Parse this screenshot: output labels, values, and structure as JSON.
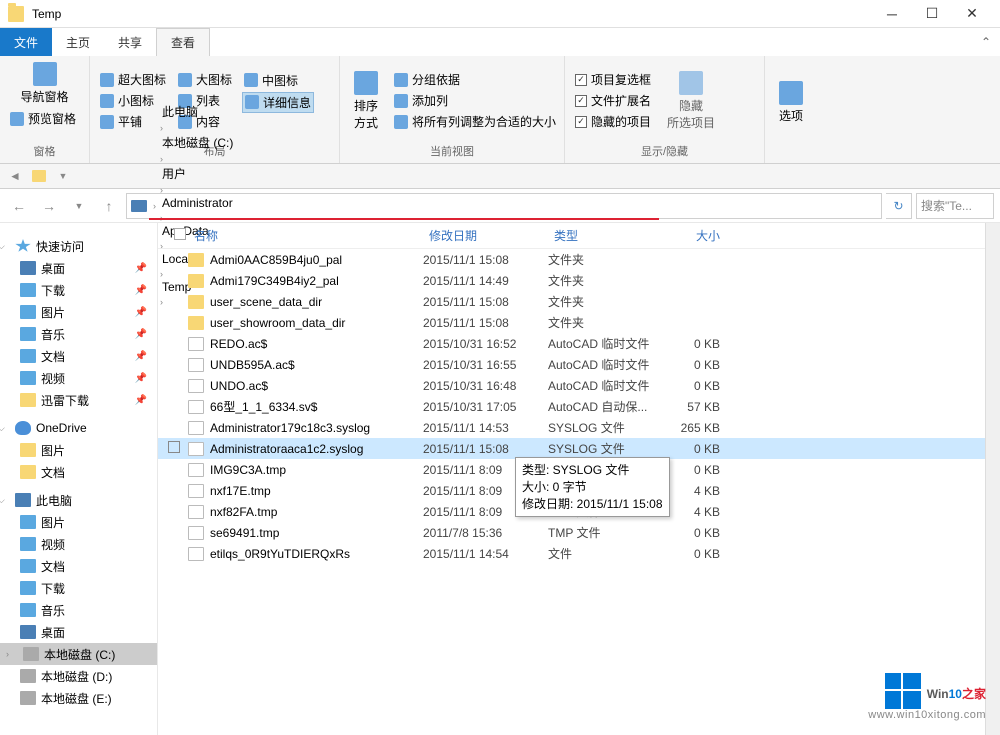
{
  "window": {
    "title": "Temp"
  },
  "tabs": {
    "file": "文件",
    "home": "主页",
    "share": "共享",
    "view": "查看"
  },
  "ribbon": {
    "panes": {
      "nav_pane": "导航窗格",
      "preview_pane": "预览窗格",
      "group": "窗格"
    },
    "layout": {
      "extra_large": "超大图标",
      "large": "大图标",
      "medium": "中图标",
      "small": "小图标",
      "list": "列表",
      "details": "详细信息",
      "tiles": "平铺",
      "content": "内容",
      "group": "布局"
    },
    "current_view": {
      "sort": "排序方式",
      "group_by": "分组依据",
      "add_columns": "添加列",
      "autosize": "将所有列调整为合适的大小",
      "group": "当前视图"
    },
    "show_hide": {
      "item_check": "项目复选框",
      "file_ext": "文件扩展名",
      "hidden_items": "隐藏的项目",
      "hide_selected": "隐藏\n所选项目",
      "group": "显示/隐藏"
    },
    "options": "选项"
  },
  "breadcrumb": [
    "此电脑",
    "本地磁盘 (C:)",
    "用户",
    "Administrator",
    "AppData",
    "Local",
    "Temp"
  ],
  "search_placeholder": "搜索\"Te...",
  "columns": {
    "name": "名称",
    "date": "修改日期",
    "type": "类型",
    "size": "大小"
  },
  "sidebar": {
    "quick_access": "快速访问",
    "desktop": "桌面",
    "downloads": "下载",
    "pictures": "图片",
    "music": "音乐",
    "documents": "文档",
    "videos": "视频",
    "xunlei": "迅雷下载",
    "onedrive": "OneDrive",
    "this_pc": "此电脑",
    "local_c": "本地磁盘 (C:)",
    "local_d": "本地磁盘 (D:)",
    "local_e": "本地磁盘 (E:)"
  },
  "files": [
    {
      "icon": "folder",
      "name": "Admi0AAC859B4ju0_pal",
      "date": "2015/11/1 15:08",
      "type": "文件夹",
      "size": ""
    },
    {
      "icon": "folder",
      "name": "Admi179C349B4iy2_pal",
      "date": "2015/11/1 14:49",
      "type": "文件夹",
      "size": ""
    },
    {
      "icon": "folder",
      "name": "user_scene_data_dir",
      "date": "2015/11/1 15:08",
      "type": "文件夹",
      "size": ""
    },
    {
      "icon": "folder",
      "name": "user_showroom_data_dir",
      "date": "2015/11/1 15:08",
      "type": "文件夹",
      "size": ""
    },
    {
      "icon": "file",
      "name": "REDO.ac$",
      "date": "2015/10/31 16:52",
      "type": "AutoCAD 临时文件",
      "size": "0 KB"
    },
    {
      "icon": "file",
      "name": "UNDB595A.ac$",
      "date": "2015/10/31 16:55",
      "type": "AutoCAD 临时文件",
      "size": "0 KB"
    },
    {
      "icon": "file",
      "name": "UNDO.ac$",
      "date": "2015/10/31 16:48",
      "type": "AutoCAD 临时文件",
      "size": "0 KB"
    },
    {
      "icon": "file",
      "name": "66型_1_1_6334.sv$",
      "date": "2015/10/31 17:05",
      "type": "AutoCAD 自动保...",
      "size": "57 KB"
    },
    {
      "icon": "file",
      "name": "Administrator179c18c3.syslog",
      "date": "2015/11/1 14:53",
      "type": "SYSLOG 文件",
      "size": "265 KB"
    },
    {
      "icon": "file",
      "name": "Administratoraaca1c2.syslog",
      "date": "2015/11/1 15:08",
      "type": "SYSLOG 文件",
      "size": "0 KB",
      "selected": true
    },
    {
      "icon": "file",
      "name": "IMG9C3A.tmp",
      "date": "2015/11/1 8:09",
      "type": "TMP 文件",
      "size": "0 KB"
    },
    {
      "icon": "file",
      "name": "nxf17E.tmp",
      "date": "2015/11/1 8:09",
      "type": "TMP 文件",
      "size": "4 KB"
    },
    {
      "icon": "file",
      "name": "nxf82FA.tmp",
      "date": "2015/11/1 8:09",
      "type": "TMP 文件",
      "size": "4 KB"
    },
    {
      "icon": "file",
      "name": "se69491.tmp",
      "date": "2011/7/8 15:36",
      "type": "TMP 文件",
      "size": "0 KB"
    },
    {
      "icon": "file",
      "name": "etilqs_0R9tYuTDIERQxRs",
      "date": "2015/11/1 14:54",
      "type": "文件",
      "size": "0 KB"
    }
  ],
  "tooltip": {
    "type_label": "类型: SYSLOG 文件",
    "size_label": "大小: 0 字节",
    "date_label": "修改日期: 2015/11/1 15:08"
  },
  "watermark": {
    "brand1": "Win",
    "brand2": "10",
    "brand3": "之家",
    "url": "www.win10xitong.com"
  }
}
